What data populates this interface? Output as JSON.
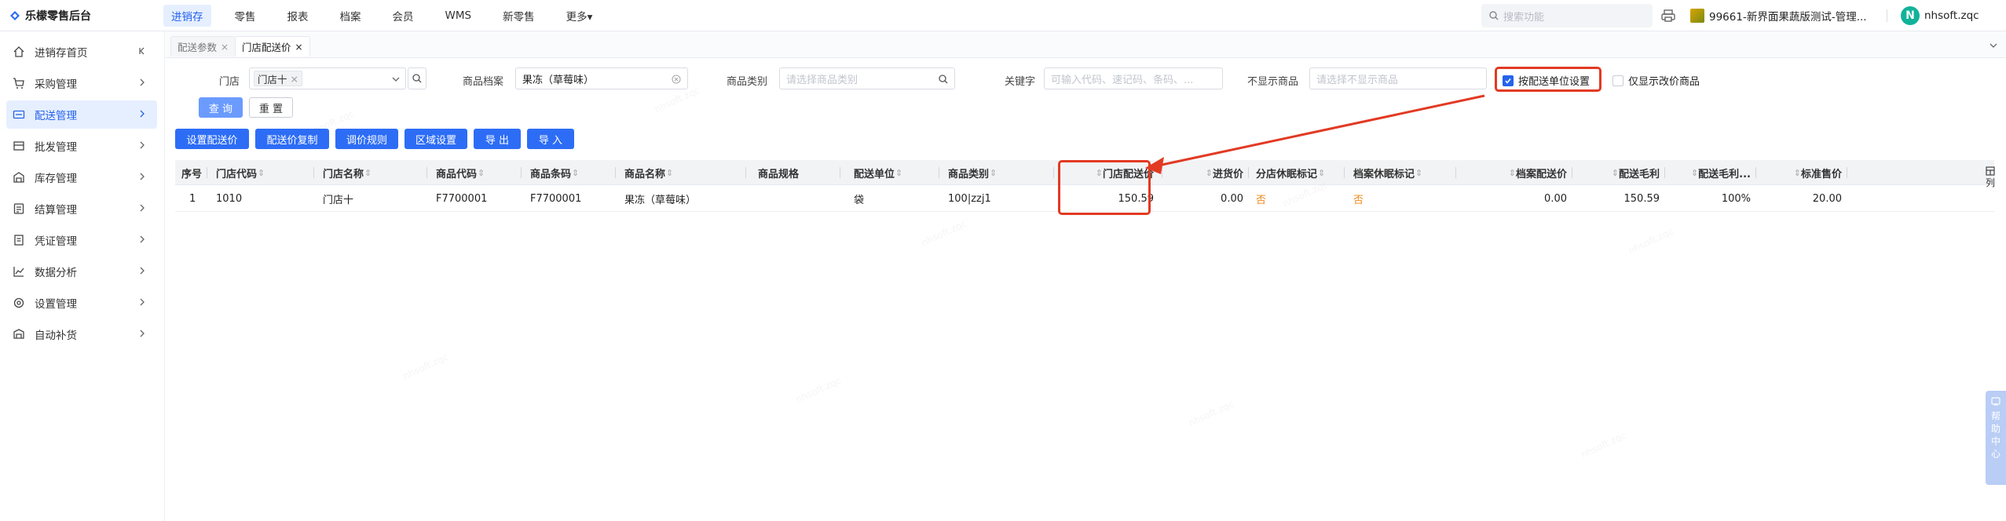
{
  "app": {
    "title": "乐檬零售后台",
    "top_nav": [
      "进销存",
      "零售",
      "报表",
      "档案",
      "会员",
      "WMS",
      "新零售",
      "更多▾"
    ],
    "search_placeholder": "搜索功能",
    "store_name": "99661-新界面果蔬版测试-管理...",
    "user_initial": "N",
    "user_name": "nhsoft.zqc"
  },
  "sidebar": {
    "items": [
      {
        "label": "进销存首页",
        "icon": "home-icon"
      },
      {
        "label": "采购管理",
        "icon": "cart-icon"
      },
      {
        "label": "配送管理",
        "icon": "truck-icon"
      },
      {
        "label": "批发管理",
        "icon": "box-icon"
      },
      {
        "label": "库存管理",
        "icon": "warehouse-icon"
      },
      {
        "label": "结算管理",
        "icon": "calculator-icon"
      },
      {
        "label": "凭证管理",
        "icon": "document-icon"
      },
      {
        "label": "数据分析",
        "icon": "chart-icon"
      },
      {
        "label": "设置管理",
        "icon": "gear-icon"
      },
      {
        "label": "自动补货",
        "icon": "refill-icon"
      }
    ],
    "active_index": 2
  },
  "tabs": [
    {
      "label": "配送参数",
      "close": "×"
    },
    {
      "label": "门店配送价",
      "close": "×"
    }
  ],
  "filters": {
    "store_label": "门店",
    "store_tag": "门店十",
    "goods_file_label": "商品档案",
    "goods_file_value": "果冻（草莓味）",
    "category_label": "商品类别",
    "category_placeholder": "请选择商品类别",
    "keyword_label": "关键字",
    "keyword_placeholder": "可输入代码、速记码、条码、...",
    "hide_label": "不显示商品",
    "hide_placeholder": "请选择不显示商品",
    "by_unit_label": "按配送单位设置",
    "by_unit_checked": true,
    "only_changed_label": "仅显示改价商品",
    "only_changed_checked": false,
    "query_button": "查 询",
    "reset_button": "重 置"
  },
  "toolbar": [
    "设置配送价",
    "配送价复制",
    "调价规则",
    "区域设置",
    "导 出",
    "导 入"
  ],
  "table": {
    "headers": [
      "序号",
      "门店代码",
      "门店名称",
      "商品代码",
      "商品条码",
      "商品名称",
      "商品规格",
      "配送单位",
      "商品类别",
      "门店配送价",
      "进货价",
      "分店休眠标记",
      "档案休眠标记",
      "档案配送价",
      "配送毛利",
      "配送毛利...",
      "标准售价"
    ],
    "rows": [
      [
        "1",
        "1010",
        "门店十",
        "F7700001",
        "F7700001",
        "果冻（草莓味）",
        "",
        "袋",
        "100|zzj1",
        "150.59",
        "0.00",
        "否",
        "否",
        "0.00",
        "150.59",
        "100%",
        "20.00"
      ]
    ]
  },
  "column_settings_label": "列",
  "help_center_label": "帮助中心",
  "colors": {
    "accent": "#2563eb",
    "primary_button": "#2d6df6",
    "highlight": "#e23a23",
    "no_flag": "#f08a1c"
  }
}
